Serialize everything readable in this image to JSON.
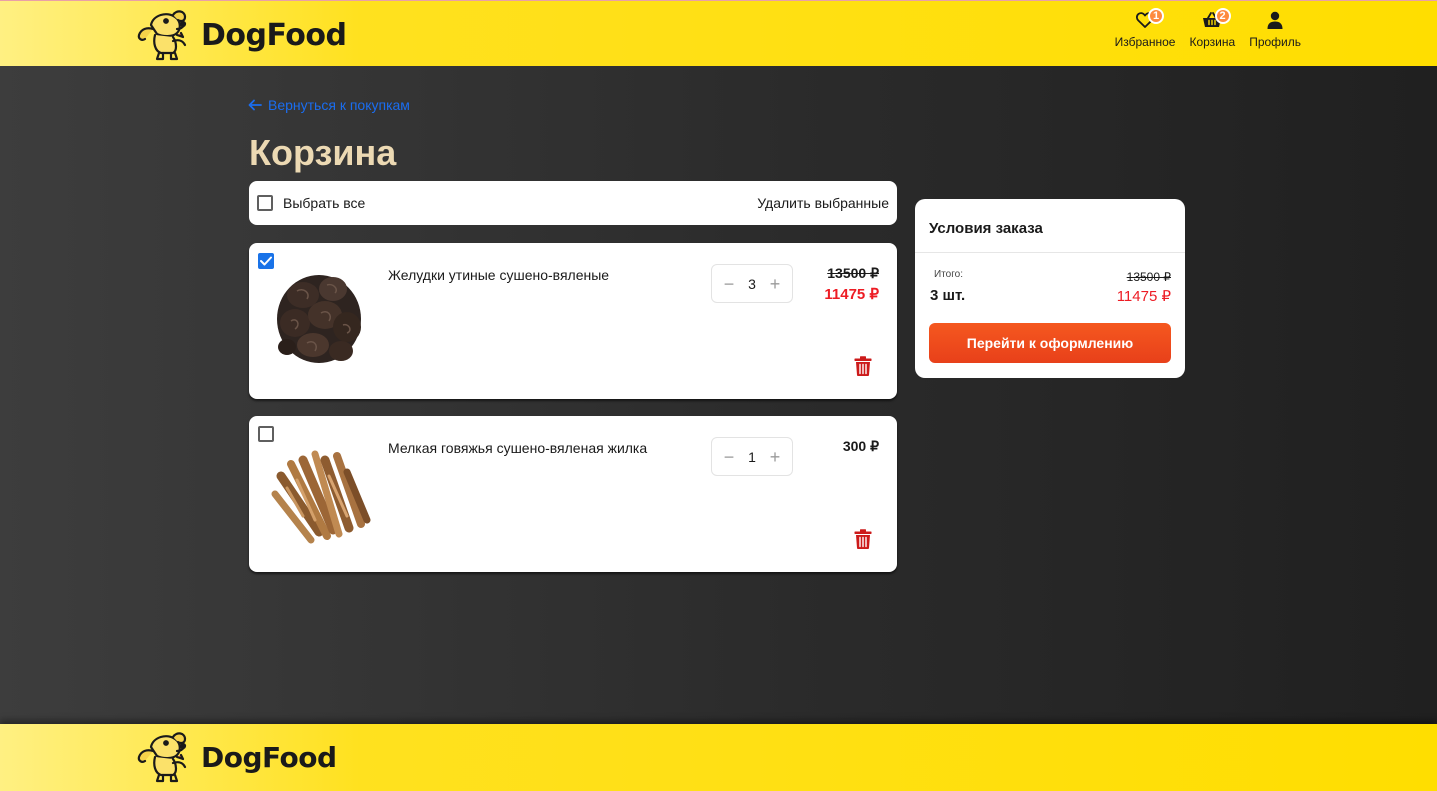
{
  "header": {
    "logo_text": "DogFood",
    "nav": [
      {
        "label": "Избранное",
        "badge": "1",
        "icon": "heart-icon"
      },
      {
        "label": "Корзина",
        "badge": "2",
        "icon": "basket-icon"
      },
      {
        "label": "Профиль",
        "icon": "user-icon"
      }
    ]
  },
  "main": {
    "back_link": "Вернуться к покупкам",
    "title": "Корзина",
    "select_all_label": "Выбрать все",
    "delete_selected_label": "Удалить выбранные",
    "items": [
      {
        "name": "Желудки утиные сушено-вяленые",
        "quantity": "3",
        "price_old": "13500 ₽",
        "price_new": "11475 ₽",
        "checked": true
      },
      {
        "name": "Мелкая говяжья сушено-вяленая жилка",
        "quantity": "1",
        "price": "300 ₽",
        "checked": false
      }
    ]
  },
  "summary": {
    "title": "Условия заказа",
    "total_label": "Итого:",
    "total_count": "3 шт.",
    "total_old": "13500 ₽",
    "total_new": "11475 ₽",
    "checkout_label": "Перейти к оформлению"
  },
  "footer": {
    "logo_text": "DogFood"
  },
  "colors": {
    "header_yellow": "#ffde00",
    "link_blue": "#1a6df0",
    "title_beige": "#ecd9b3",
    "price_red": "#ed1c24",
    "checkout_orange": "#f5581f",
    "badge_orange": "#fe8a3e",
    "checkbox_blue": "#1a73e8"
  }
}
